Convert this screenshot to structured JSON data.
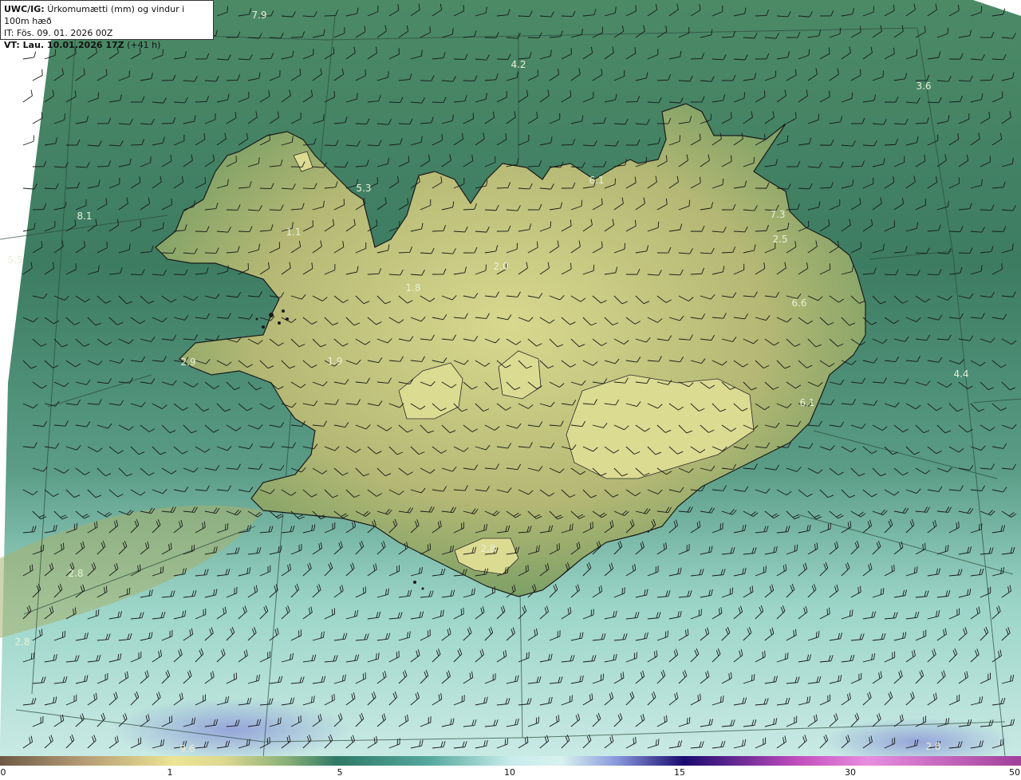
{
  "header": {
    "product": "UWC/IG:",
    "title": "Úrkomumætti (mm) og vindur i 100m hæð",
    "issue_time": "IT: Fös. 09. 01. 2026 00Z",
    "valid_prefix": "VT: Lau. 10.01.2026 17Z",
    "valid_lead": "(+41 h)"
  },
  "colorbar": {
    "ticks": [
      {
        "label": "0",
        "value": 0
      },
      {
        "label": "1",
        "value": 1
      },
      {
        "label": "5",
        "value": 5
      },
      {
        "label": "10",
        "value": 10
      },
      {
        "label": "15",
        "value": 15
      },
      {
        "label": "30",
        "value": 30
      },
      {
        "label": "50",
        "value": 50
      }
    ],
    "colors": [
      "#6e5a44",
      "#b49a74",
      "#ece494",
      "#dcd890",
      "#5c8c5c",
      "#2f7a66",
      "#55a89e",
      "#a8ddd6",
      "#d8f2ee",
      "#8ea0e0",
      "#3a2fa0",
      "#1a0a70",
      "#c04cbc",
      "#e88ee0",
      "#a0409a"
    ]
  },
  "field_labels": [
    {
      "text": "7.9"
    },
    {
      "text": "4.2"
    },
    {
      "text": "3.6"
    },
    {
      "text": "5.3"
    },
    {
      "text": "6.1"
    },
    {
      "text": "7.3"
    },
    {
      "text": "2.5"
    },
    {
      "text": "8.1"
    },
    {
      "text": "5.5"
    },
    {
      "text": "1.1"
    },
    {
      "text": "2.0"
    },
    {
      "text": "1.8"
    },
    {
      "text": "6.6"
    },
    {
      "text": "2.9"
    },
    {
      "text": "1.9"
    },
    {
      "text": "4.4"
    },
    {
      "text": "6.1"
    },
    {
      "text": "2.8"
    },
    {
      "text": "2.8"
    },
    {
      "text": "2.8"
    },
    {
      "text": "9.6"
    },
    {
      "text": "2.8"
    }
  ],
  "colors": {
    "land": "#a8b36a",
    "land_high": "#d6d88e",
    "sea_north": "#3f7f63",
    "sea_south": "#8fd1c4",
    "coast": "#1a1a1a"
  }
}
